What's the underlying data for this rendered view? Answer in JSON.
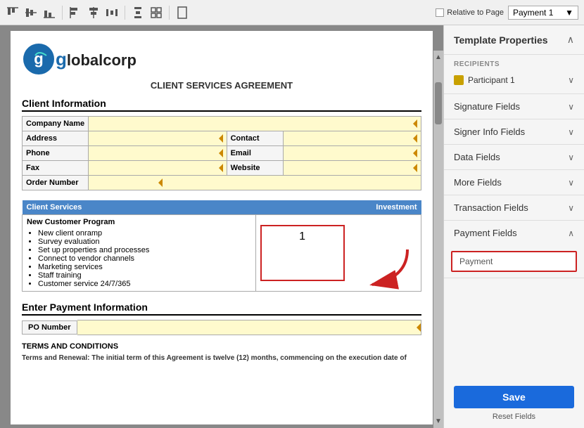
{
  "toolbar": {
    "relative_label": "Relative to Page",
    "page_dropdown": "Payment 1",
    "icons": [
      "align-top",
      "align-middle",
      "align-bottom",
      "align-left",
      "align-center",
      "align-right",
      "distribute-h",
      "distribute-v",
      "more"
    ]
  },
  "document": {
    "logo_letter": "g",
    "logo_company": "lobalcorp",
    "doc_title": "CLIENT SERVICES AGREEMENT",
    "client_info_title": "Client Information",
    "fields": {
      "company_name": "Company Name",
      "address": "Address",
      "contact": "Contact",
      "phone": "Phone",
      "email": "Email",
      "fax": "Fax",
      "website": "Website",
      "order_number": "Order Number"
    },
    "services_title": "Client Services",
    "investment_col": "Investment",
    "program_name": "New Customer Program",
    "program_items": [
      "New client onramp",
      "Survey evaluation",
      "Set up properties and processes",
      "Connect to vendor channels",
      "Marketing services",
      "Staff training",
      "Customer service 24/7/365"
    ],
    "investment_value": "1",
    "payment_title": "Enter Payment Information",
    "po_label": "PO Number",
    "terms_title": "TERMS AND CONDITIONS",
    "terms_text": "Terms and Renewal: The initial term of this Agreement is twelve (12) months, commencing on the execution date of"
  },
  "right_panel": {
    "title": "Template Properties",
    "recipients_label": "RECIPIENTS",
    "participant": "Participant 1",
    "accordion_items": [
      {
        "label": "Signature Fields",
        "expanded": false
      },
      {
        "label": "Signer Info Fields",
        "expanded": false
      },
      {
        "label": "Data Fields",
        "expanded": false
      },
      {
        "label": "More Fields",
        "expanded": false
      },
      {
        "label": "Transaction Fields",
        "expanded": false
      },
      {
        "label": "Payment Fields",
        "expanded": true
      }
    ],
    "payment_field_label": "Payment",
    "save_label": "Save",
    "reset_label": "Reset Fields"
  }
}
